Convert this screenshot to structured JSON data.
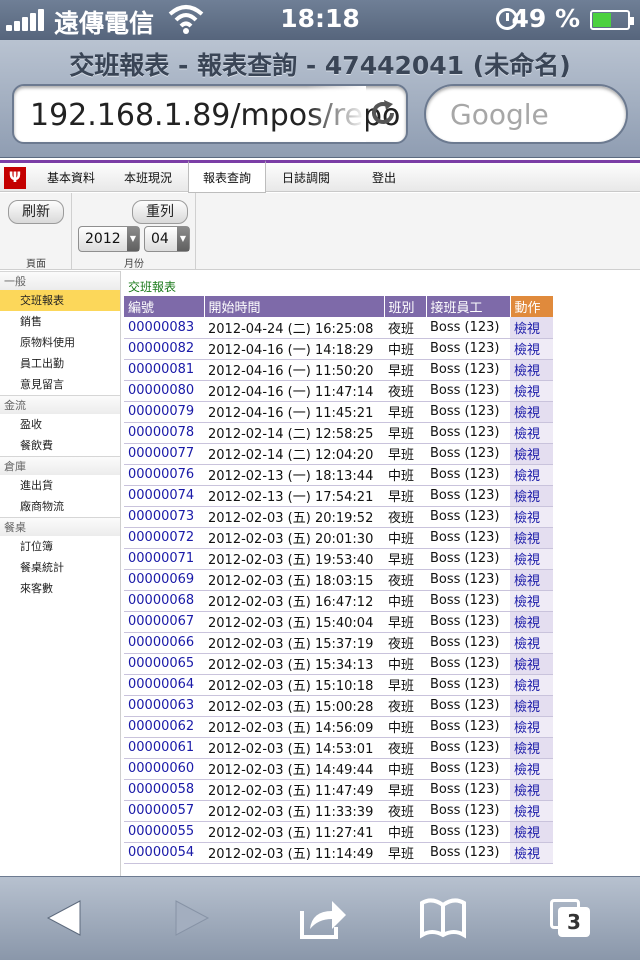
{
  "status_bar": {
    "carrier": "遠傳電信",
    "time": "18:18",
    "battery": "49 %"
  },
  "browser": {
    "page_title": "交班報表 - 報表查詢 - 47442041 (未命名)",
    "url": "192.168.1.89/mpos/repo",
    "search_placeholder": "Google"
  },
  "nav_tabs": [
    {
      "label": "基本資料",
      "active": false
    },
    {
      "label": "本班現況",
      "active": false
    },
    {
      "label": "報表查詢",
      "active": true
    },
    {
      "label": "日誌調閱",
      "active": false
    },
    {
      "label": "登出",
      "active": false
    }
  ],
  "toolbar": {
    "refresh_label": "刷新",
    "reorder_label": "重列",
    "page_group_label": "頁面",
    "month_group_label": "月份",
    "year_value": "2012",
    "month_value": "04"
  },
  "sidebar": {
    "sections": [
      {
        "title": "一般",
        "items": [
          {
            "label": "交班報表",
            "active": true
          },
          {
            "label": "銷售"
          },
          {
            "label": "原物料使用"
          },
          {
            "label": "員工出勤"
          },
          {
            "label": "意見留言"
          }
        ]
      },
      {
        "title": "金流",
        "items": [
          {
            "label": "盈收"
          },
          {
            "label": "餐飲費"
          }
        ]
      },
      {
        "title": "倉庫",
        "items": [
          {
            "label": "進出貨"
          },
          {
            "label": "廠商物流"
          }
        ]
      },
      {
        "title": "餐桌",
        "items": [
          {
            "label": "訂位簿"
          },
          {
            "label": "餐桌統計"
          },
          {
            "label": "來客數"
          }
        ]
      }
    ]
  },
  "report": {
    "title": "交班報表",
    "columns": [
      "編號",
      "開始時間",
      "班別",
      "接班員工",
      "動作"
    ],
    "action_label": "檢視",
    "rows": [
      [
        "00000083",
        "2012-04-24 (二) 16:25:08",
        "夜班",
        "Boss (123)"
      ],
      [
        "00000082",
        "2012-04-16 (一) 14:18:29",
        "中班",
        "Boss (123)"
      ],
      [
        "00000081",
        "2012-04-16 (一) 11:50:20",
        "早班",
        "Boss (123)"
      ],
      [
        "00000080",
        "2012-04-16 (一) 11:47:14",
        "夜班",
        "Boss (123)"
      ],
      [
        "00000079",
        "2012-04-16 (一) 11:45:21",
        "早班",
        "Boss (123)"
      ],
      [
        "00000078",
        "2012-02-14 (二) 12:58:25",
        "早班",
        "Boss (123)"
      ],
      [
        "00000077",
        "2012-02-14 (二) 12:04:20",
        "早班",
        "Boss (123)"
      ],
      [
        "00000076",
        "2012-02-13 (一) 18:13:44",
        "中班",
        "Boss (123)"
      ],
      [
        "00000074",
        "2012-02-13 (一) 17:54:21",
        "早班",
        "Boss (123)"
      ],
      [
        "00000073",
        "2012-02-03 (五) 20:19:52",
        "夜班",
        "Boss (123)"
      ],
      [
        "00000072",
        "2012-02-03 (五) 20:01:30",
        "中班",
        "Boss (123)"
      ],
      [
        "00000071",
        "2012-02-03 (五) 19:53:40",
        "早班",
        "Boss (123)"
      ],
      [
        "00000069",
        "2012-02-03 (五) 18:03:15",
        "夜班",
        "Boss (123)"
      ],
      [
        "00000068",
        "2012-02-03 (五) 16:47:12",
        "中班",
        "Boss (123)"
      ],
      [
        "00000067",
        "2012-02-03 (五) 15:40:04",
        "早班",
        "Boss (123)"
      ],
      [
        "00000066",
        "2012-02-03 (五) 15:37:19",
        "夜班",
        "Boss (123)"
      ],
      [
        "00000065",
        "2012-02-03 (五) 15:34:13",
        "中班",
        "Boss (123)"
      ],
      [
        "00000064",
        "2012-02-03 (五) 15:10:18",
        "早班",
        "Boss (123)"
      ],
      [
        "00000063",
        "2012-02-03 (五) 15:00:28",
        "夜班",
        "Boss (123)"
      ],
      [
        "00000062",
        "2012-02-03 (五) 14:56:09",
        "中班",
        "Boss (123)"
      ],
      [
        "00000061",
        "2012-02-03 (五) 14:53:01",
        "夜班",
        "Boss (123)"
      ],
      [
        "00000060",
        "2012-02-03 (五) 14:49:44",
        "中班",
        "Boss (123)"
      ],
      [
        "00000058",
        "2012-02-03 (五) 11:47:49",
        "早班",
        "Boss (123)"
      ],
      [
        "00000057",
        "2012-02-03 (五) 11:33:39",
        "夜班",
        "Boss (123)"
      ],
      [
        "00000055",
        "2012-02-03 (五) 11:27:41",
        "中班",
        "Boss (123)"
      ],
      [
        "00000054",
        "2012-02-03 (五) 11:14:49",
        "早班",
        "Boss (123)"
      ]
    ]
  },
  "bottom_bar": {
    "tabs_count": "3"
  },
  "colors": {
    "accent_purple": "#7e6aa9",
    "action_header": "#e08a3c",
    "active_sidebar": "#fcd75a"
  }
}
